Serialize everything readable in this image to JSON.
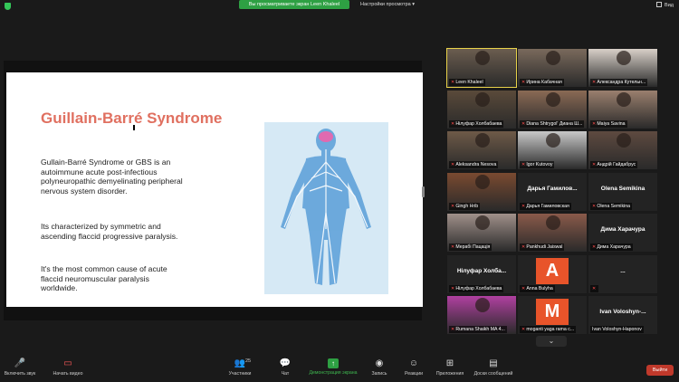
{
  "topbar": {
    "viewing_banner": "Вы просматриваете экран Leen Khaleel",
    "view_settings": "Настройки просмотра",
    "view_mode": "Вид"
  },
  "slide": {
    "title": "Guillain-Barré Syndrome",
    "paragraph1": "Gullain-Barré Syndrome or GBS is an autoimmune acute post-infectious polyneuropathic demyelinating peripheral nervous system disorder.",
    "paragraph2": "Its characterized by symmetric and ascending flaccid progressive paralysis.",
    "paragraph3": "It's the most common cause of acute flaccid neuromuscular paralysis worldwide."
  },
  "gallery": {
    "tiles": [
      {
        "label": "Leen Khaleel",
        "muted": true,
        "active": true,
        "color": "#6b5d4f"
      },
      {
        "label": "Ирина Кабачная",
        "muted": true,
        "color": "#7a6a5c"
      },
      {
        "label": "Александра Кутельн...",
        "muted": true,
        "color": "#d8d0c8"
      },
      {
        "label": "Нілуфар Холбабаева",
        "muted": true,
        "color": "#5a4a3a"
      },
      {
        "label": "Diana Shtrygol' Диана Ш...",
        "muted": true,
        "color": "#8a6a55"
      },
      {
        "label": "Maiya Savina",
        "muted": true,
        "color": "#9a7f6e"
      },
      {
        "label": "Aleksandra Nesova",
        "muted": true,
        "color": "#6e5a48"
      },
      {
        "label": "Igor Kutovoy",
        "muted": true,
        "color": "#c8c8c8"
      },
      {
        "label": "Андрій Гайдабрус",
        "muted": true,
        "color": "#5e4a40"
      },
      {
        "label": "Gingh Hrib",
        "muted": true,
        "color": "#7a4a30"
      },
      {
        "label": "Дарья Гамиловская",
        "muted": true,
        "center": "Дарья Гамилов..."
      },
      {
        "label": "Olena Semikina",
        "muted": true,
        "center": "Olena Semikina"
      },
      {
        "label": "Мерабі Пацація",
        "muted": true,
        "color": "#a0908a"
      },
      {
        "label": "Pankhudi Jaiswal",
        "muted": true,
        "color": "#8a5a4a"
      },
      {
        "label": "Дима Харачура",
        "muted": true,
        "center": "Дима Харачура"
      },
      {
        "label": "Нілуфар Холбабаева",
        "muted": true,
        "center": "Нілуфар Холба..."
      },
      {
        "label": "Anna Bulyha",
        "muted": true,
        "letter": "A",
        "letter_color": "#e8542a"
      },
      {
        "label": "",
        "muted": true,
        "center": "..."
      },
      {
        "label": "Rumana Shaikh MA 4...",
        "muted": true,
        "color": "#b040a0"
      },
      {
        "label": "moganti yaga rama c...",
        "muted": true,
        "letter": "M",
        "letter_color": "#e8542a"
      },
      {
        "label": "Ivan Voloshyn-Haponov",
        "muted": false,
        "center": "Ivan Voloshyn-..."
      }
    ],
    "expand_icon": "chevron-down-icon"
  },
  "toolbar": {
    "mute": "Включить звук",
    "video": "Начать видео",
    "participants": "Участники",
    "participants_count": "25",
    "chat": "Чат",
    "share": "Демонстрация экрана",
    "record": "Запись",
    "reactions": "Реакции",
    "apps": "Приложения",
    "whiteboard": "Доски сообщений",
    "leave": "Выйти"
  },
  "colors": {
    "share_green": "#2ea043",
    "leave_red": "#c0392b",
    "title_salmon": "#e07060",
    "active_speaker": "#e8d24a"
  }
}
